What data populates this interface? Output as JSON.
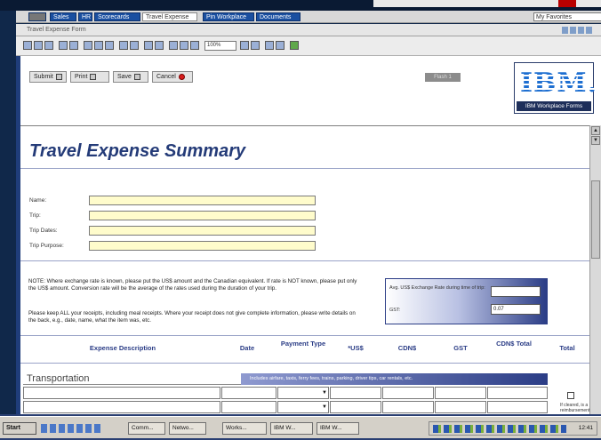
{
  "browser": {
    "tabs": [
      {
        "label": "Sales"
      },
      {
        "label": "HR"
      },
      {
        "label": "Scorecards"
      },
      {
        "label": "Travel Expense"
      },
      {
        "label": "Pin Workplace"
      },
      {
        "label": "Documents"
      }
    ],
    "favorites_label": "My Favorites",
    "form_title": "Travel Expense Form",
    "zoom": "100%"
  },
  "actions": {
    "submit_label": "Submit",
    "print_label": "Print",
    "save_label": "Save",
    "cancel_label": "Cancel",
    "status_button_label": "Flash 1"
  },
  "logo": {
    "text": "IBM.",
    "caption": "IBM Workplace Forms"
  },
  "form": {
    "title": "Travel Expense Summary",
    "fields": [
      {
        "label": "Name:"
      },
      {
        "label": "Trip:"
      },
      {
        "label": "Trip Dates:"
      },
      {
        "label": "Trip Purpose:"
      }
    ],
    "note": "NOTE: Where exchange rate is known, please put the US$ amount and the Canadian equivalent. If rate is NOT known, please put only the US$ amount. Conversion rate will be the average of the rates used during the duration of your trip.",
    "note2": "Please keep ALL your receipts, including meal receipts. Where your receipt does not give complete information, please write details on the back, e.g., date, name, what the item was, etc.",
    "exchange_label": "Avg. US$ Exchange Rate during time of trip:",
    "gst_label": "GST:",
    "gst_value": "0.07"
  },
  "table": {
    "columns": [
      "Expense Description",
      "Date",
      "Payment Type",
      "*US$",
      "CDN$",
      "GST",
      "CDN$ Total",
      "Total"
    ],
    "section_name": "Transportation",
    "section_hint": "Includes airfare, taxis, ferry fees, trains, parking, driver tips, car rentals, etc.",
    "checkbox_note": "If cleared, is a reimbursement"
  },
  "taskbar": {
    "start_label": "Start",
    "items": [
      "Comm...",
      "Netwo...",
      "Works...",
      "IBM W...",
      "IBM W..."
    ],
    "clock": "12:41"
  }
}
